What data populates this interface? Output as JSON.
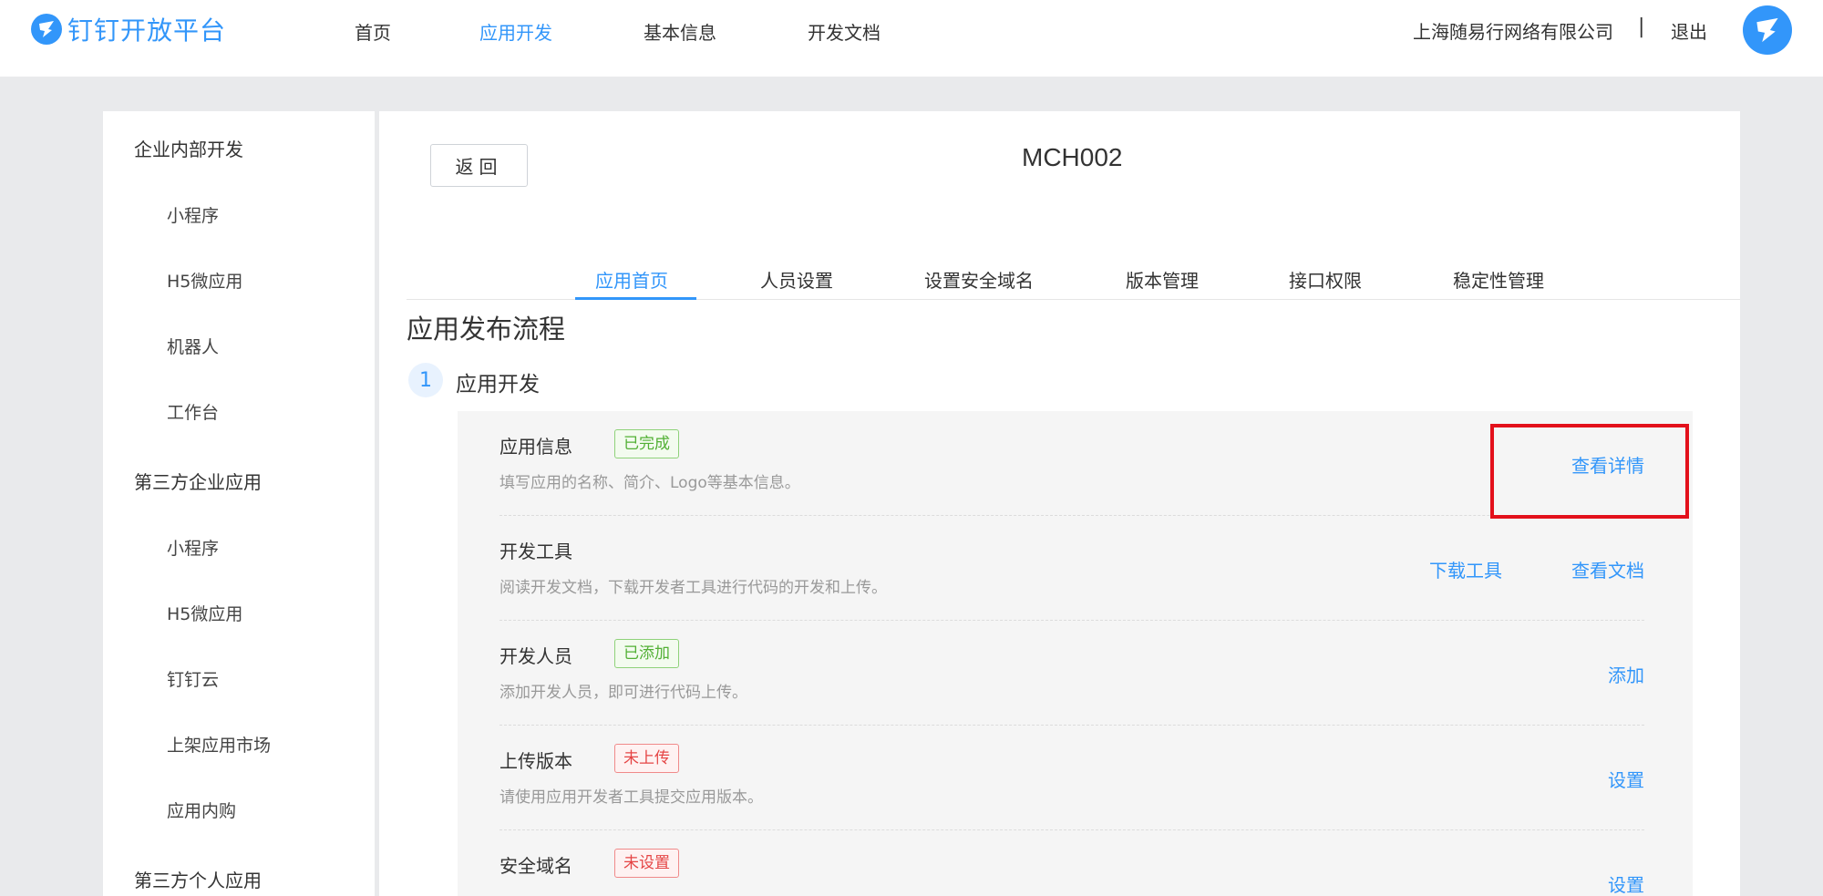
{
  "topbar": {
    "logo_text": "钉钉开放平台",
    "nav": [
      {
        "label": "首页",
        "active": false
      },
      {
        "label": "应用开发",
        "active": true
      },
      {
        "label": "基本信息",
        "active": false
      },
      {
        "label": "开发文档",
        "active": false
      }
    ],
    "company": "上海随易行网络有限公司",
    "divider": "|",
    "logout": "退出"
  },
  "sidebar": {
    "groups": [
      {
        "label": "企业内部开发",
        "items": [
          "小程序",
          "H5微应用",
          "机器人",
          "工作台"
        ]
      },
      {
        "label": "第三方企业应用",
        "items": [
          "小程序",
          "H5微应用",
          "钉钉云",
          "上架应用市场",
          "应用内购"
        ]
      },
      {
        "label": "第三方个人应用",
        "items": []
      }
    ]
  },
  "main": {
    "back_label": "返回",
    "app_name": "MCH002",
    "tabs": [
      "应用首页",
      "人员设置",
      "设置安全域名",
      "版本管理",
      "接口权限",
      "稳定性管理"
    ],
    "active_tab": "应用首页",
    "section_title": "应用发布流程",
    "step": {
      "number": "1",
      "label": "应用开发"
    },
    "rows": [
      {
        "title": "应用信息",
        "badge": "已完成",
        "badge_type": "ok",
        "desc": "填写应用的名称、简介、Logo等基本信息。",
        "actions": [
          "查看详情"
        ]
      },
      {
        "title": "开发工具",
        "badge": "",
        "badge_type": "",
        "desc": "阅读开发文档，下载开发者工具进行代码的开发和上传。",
        "actions": [
          "下载工具",
          "查看文档"
        ]
      },
      {
        "title": "开发人员",
        "badge": "已添加",
        "badge_type": "ok",
        "desc": "添加开发人员，即可进行代码上传。",
        "actions": [
          "添加"
        ]
      },
      {
        "title": "上传版本",
        "badge": "未上传",
        "badge_type": "bad",
        "desc": "请使用应用开发者工具提交应用版本。",
        "actions": [
          "设置"
        ]
      },
      {
        "title": "安全域名",
        "badge": "未设置",
        "badge_type": "bad",
        "desc": "",
        "actions": [
          "设置"
        ]
      }
    ]
  },
  "colors": {
    "accent": "#3296fa",
    "success": "#52b035",
    "danger": "#e54545",
    "highlight": "#e3101b"
  }
}
